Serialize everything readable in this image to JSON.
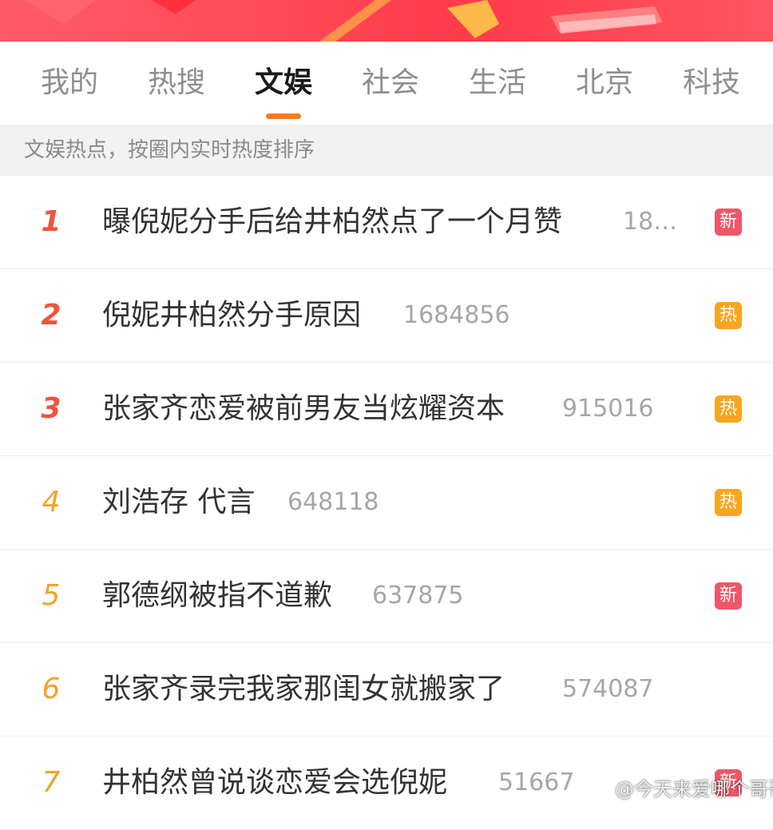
{
  "colors": {
    "banner": "#ff4d57",
    "active_tab": "#1a1a1a",
    "inactive_tab": "#8e8e8e",
    "tab_underline": "#ff7b1c",
    "rank_top": "#f2543a",
    "rank_other": "#f5a223",
    "badge_new": "#f0566a",
    "badge_hot": "#f8a51e",
    "count_text": "#a6a6a6"
  },
  "tabs": [
    {
      "label": "我的"
    },
    {
      "label": "热搜"
    },
    {
      "label": "文娱"
    },
    {
      "label": "社会"
    },
    {
      "label": "生活"
    },
    {
      "label": "北京"
    },
    {
      "label": "科技"
    }
  ],
  "active_tab": "文娱",
  "subheader": "文娱热点，按圈内实时热度排序",
  "items": [
    {
      "rank": "1",
      "title": "曝倪妮分手后给井柏然点了一个月赞",
      "count": "18…",
      "badge": "新",
      "badge_type": "new"
    },
    {
      "rank": "2",
      "title": "倪妮井柏然分手原因",
      "count": "1684856",
      "badge": "热",
      "badge_type": "hot"
    },
    {
      "rank": "3",
      "title": "张家齐恋爱被前男友当炫耀资本",
      "count": "915016",
      "badge": "热",
      "badge_type": "hot"
    },
    {
      "rank": "4",
      "title": "刘浩存 代言",
      "count": "648118",
      "badge": "热",
      "badge_type": "hot"
    },
    {
      "rank": "5",
      "title": "郭德纲被指不道歉",
      "count": "637875",
      "badge": "新",
      "badge_type": "new"
    },
    {
      "rank": "6",
      "title": "张家齐录完我家那闺女就搬家了",
      "count": "574087",
      "badge": "",
      "badge_type": ""
    },
    {
      "rank": "7",
      "title": "井柏然曾说谈恋爱会选倪妮",
      "count": "51667",
      "badge": "新",
      "badge_type": "new"
    }
  ],
  "watermark": "@今天来爱哪个哥哥"
}
